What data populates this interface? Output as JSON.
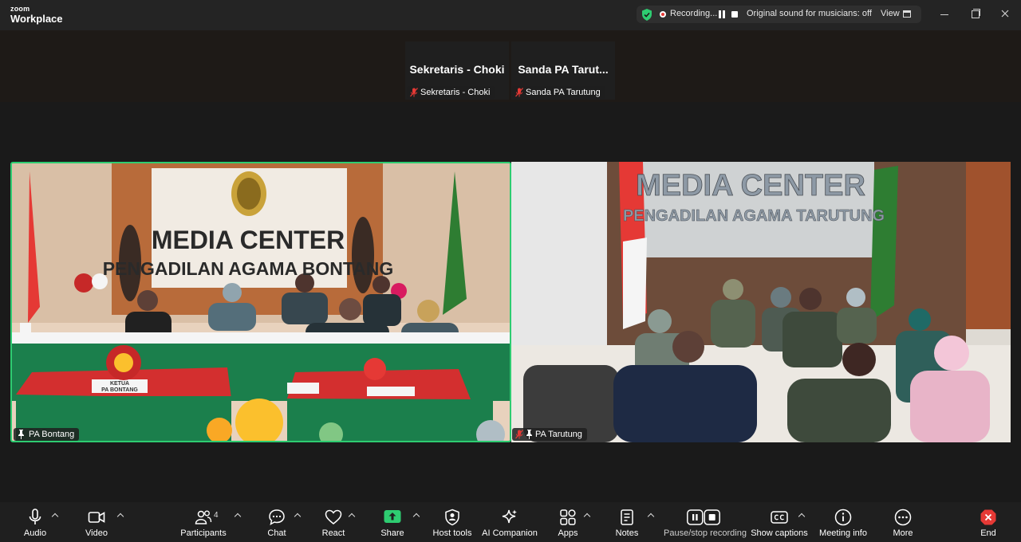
{
  "app": {
    "logo_line1": "zoom",
    "logo_line2": "Workplace"
  },
  "recording": {
    "status": "Recording...",
    "sound": "Original sound for musicians: off",
    "view": "View"
  },
  "gallery": [
    {
      "display_name": "Sekretaris - Choki",
      "tag": "Sekretaris - Choki"
    },
    {
      "display_name": "Sanda PA Tarut...",
      "tag": "Sanda PA Tarutung"
    }
  ],
  "tiles": {
    "left": {
      "label": "PA Bontang",
      "sign_line1": "MEDIA CENTER",
      "sign_line2": "PENGADILAN AGAMA BONTANG",
      "desk_sign1": "KETUA",
      "desk_sign2": "PA BONTANG"
    },
    "right": {
      "label": "PA Tarutung",
      "sign_line1": "MEDIA CENTER",
      "sign_line2": "PENGADILAN AGAMA TARUTUNG"
    }
  },
  "toolbar": {
    "audio": "Audio",
    "video": "Video",
    "participants": "Participants",
    "participant_count": "4",
    "chat": "Chat",
    "react": "React",
    "share": "Share",
    "host_tools": "Host tools",
    "ai_companion": "AI Companion",
    "apps": "Apps",
    "notes": "Notes",
    "pause_stop": "Pause/stop recording",
    "captions": "Show captions",
    "meeting_info": "Meeting info",
    "more": "More",
    "end": "End"
  },
  "colors": {
    "active_speaker": "#2ecc71",
    "share": "#2ecc71",
    "end": "#e53935",
    "rec": "#e53935"
  }
}
